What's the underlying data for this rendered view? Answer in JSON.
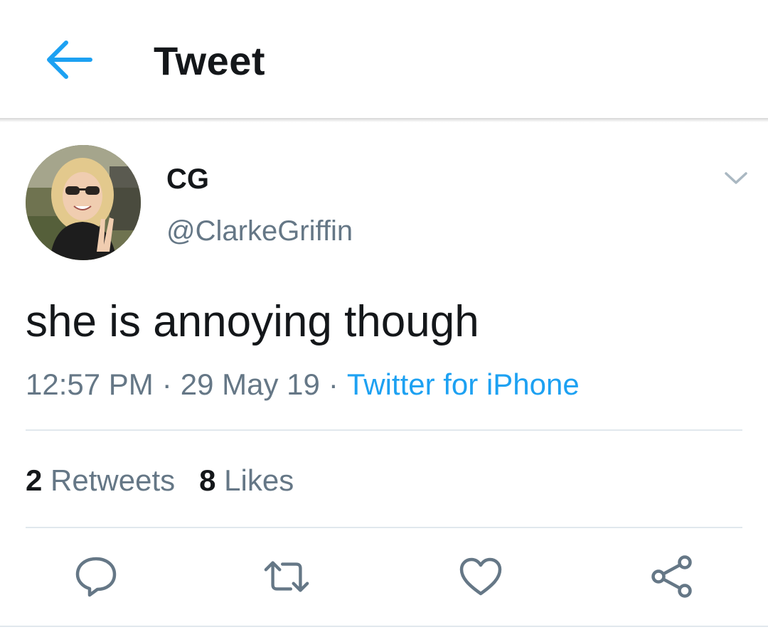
{
  "header": {
    "title": "Tweet",
    "back_icon": "arrow-left-icon",
    "accent_color": "#1da1f2"
  },
  "tweet": {
    "author": {
      "display_name": "CG",
      "handle": "@ClarkeGriffin"
    },
    "text": "she is annoying though",
    "time": "12:57 PM",
    "date": "29 May 19",
    "source": "Twitter for iPhone",
    "separator": "·",
    "retweets": {
      "count": "2",
      "label": "Retweets"
    },
    "likes": {
      "count": "8",
      "label": "Likes"
    }
  },
  "actions": [
    {
      "name": "reply",
      "icon": "reply-icon"
    },
    {
      "name": "retweet",
      "icon": "retweet-icon"
    },
    {
      "name": "like",
      "icon": "heart-icon"
    },
    {
      "name": "share",
      "icon": "share-icon"
    }
  ],
  "colors": {
    "text_primary": "#14171a",
    "text_secondary": "#657786",
    "link": "#1da1f2",
    "divider": "#e1e8ed"
  }
}
